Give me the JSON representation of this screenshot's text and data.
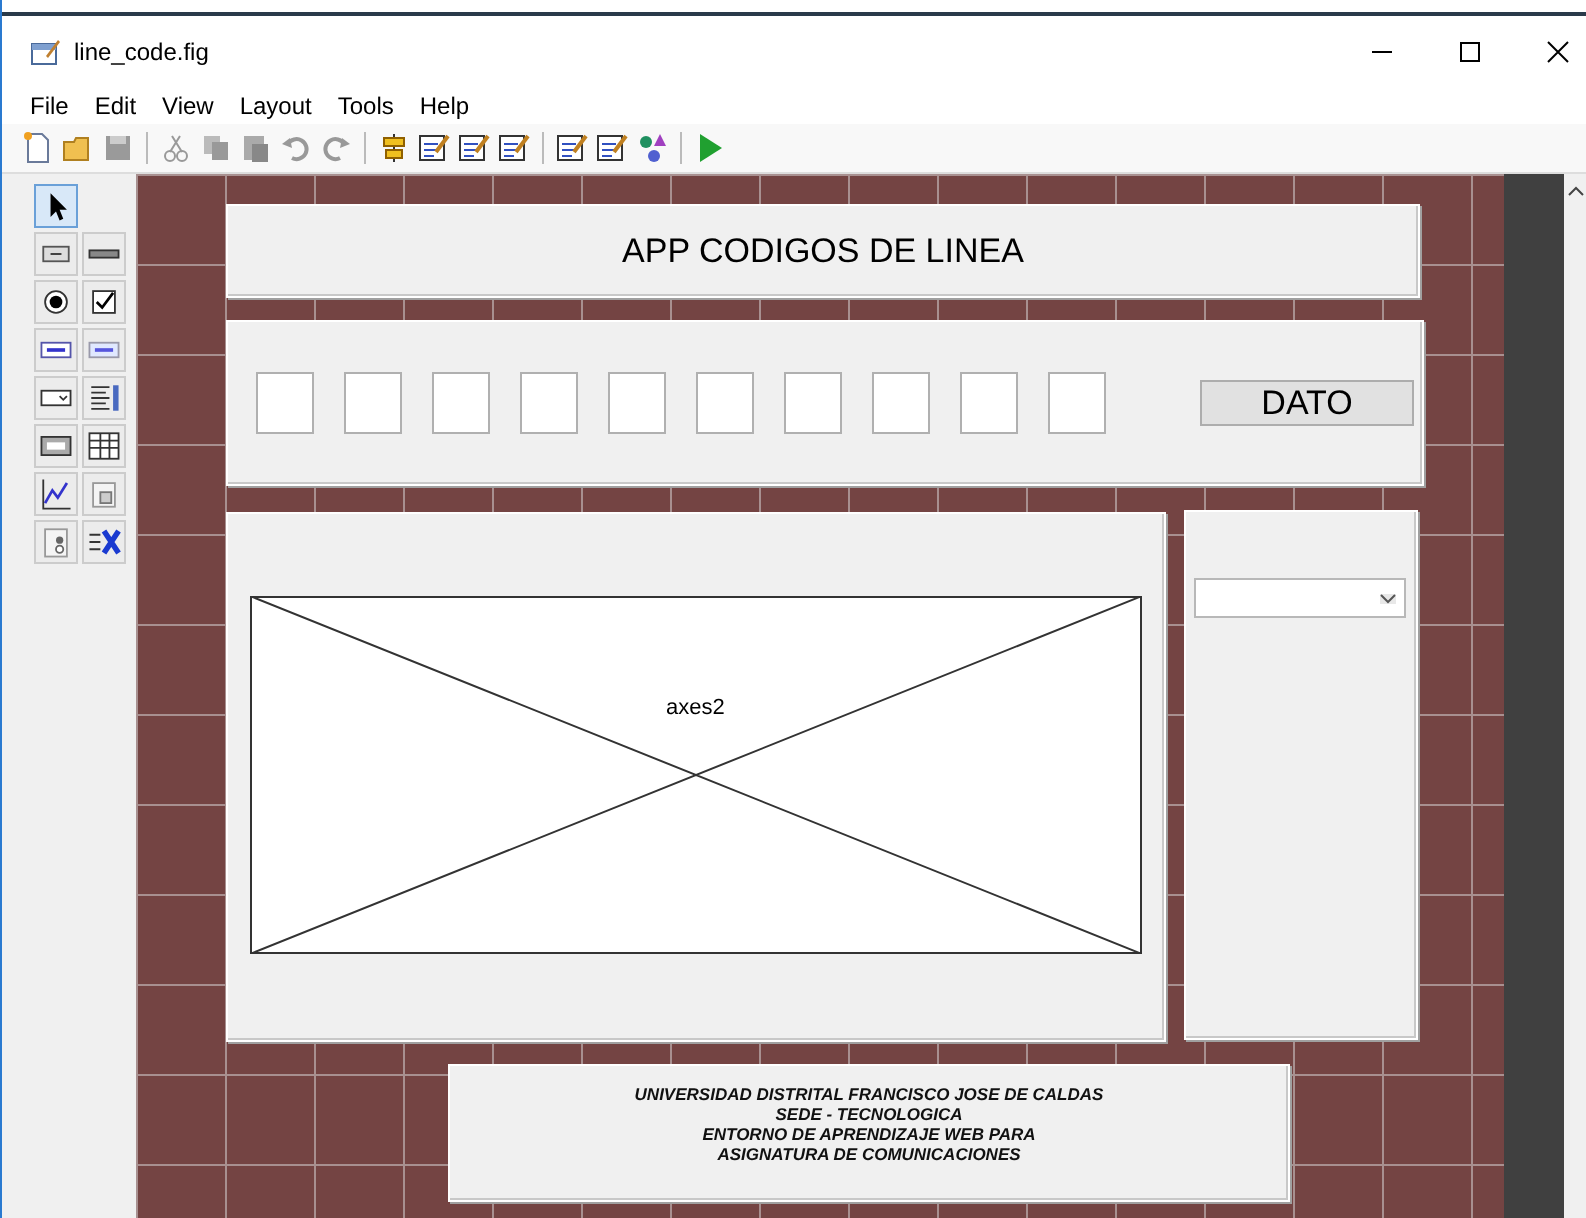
{
  "window": {
    "title": "line_code.fig"
  },
  "menu": [
    "File",
    "Edit",
    "View",
    "Layout",
    "Tools",
    "Help"
  ],
  "palette": [
    {
      "selected": true
    },
    {
      "selected": false
    },
    {
      "selected": false
    },
    {
      "selected": false
    },
    {
      "selected": false
    },
    {
      "selected": false
    },
    {
      "selected": false
    },
    {
      "selected": false
    },
    {
      "selected": false
    },
    {
      "selected": false
    },
    {
      "selected": false
    },
    {
      "selected": false
    },
    {
      "selected": false
    },
    {
      "selected": false
    },
    {
      "selected": false
    }
  ],
  "title_panel": {
    "text": "APP CODIGOS DE LINEA"
  },
  "input_panel": {
    "controls": [
      {
        "kind": "edit"
      },
      {
        "kind": "edit"
      },
      {
        "kind": "edit"
      },
      {
        "kind": "edit"
      },
      {
        "kind": "edit"
      },
      {
        "kind": "edit"
      },
      {
        "kind": "edit"
      },
      {
        "kind": "edit"
      },
      {
        "kind": "edit"
      },
      {
        "kind": "edit"
      },
      {
        "kind": "button",
        "label": "DATO"
      }
    ]
  },
  "axes_panel": {
    "axes_label": "axes2"
  },
  "footer_panel": {
    "lines": [
      "UNIVERSIDAD DISTRITAL FRANCISCO JOSE DE CALDAS",
      "SEDE - TECNOLOGICA",
      "ENTORNO DE APRENDIZAJE WEB PARA",
      "ASIGNATURA DE COMUNICACIONES"
    ]
  }
}
